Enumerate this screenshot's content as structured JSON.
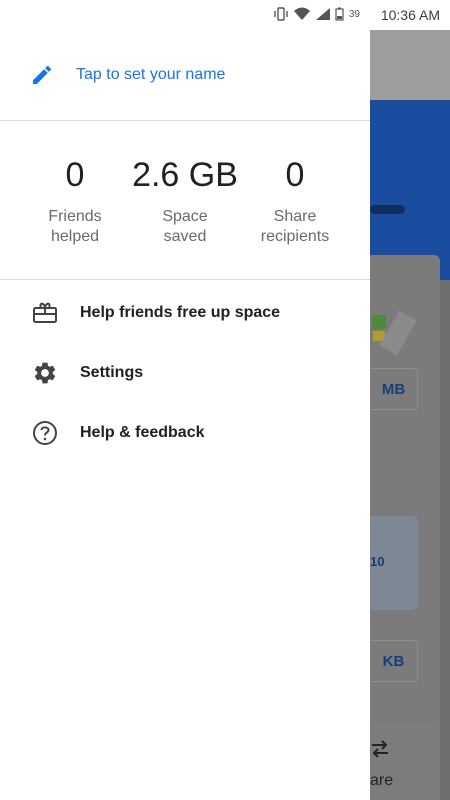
{
  "status_bar": {
    "time": "10:36 AM",
    "battery_level": "39",
    "icons": [
      "vibrate-icon",
      "wifi-icon",
      "signal-icon",
      "battery-icon"
    ]
  },
  "drawer": {
    "name_prompt": "Tap to set your name",
    "stats": [
      {
        "value": "0",
        "label_line1": "Friends",
        "label_line2": "helped"
      },
      {
        "value": "2.6 GB",
        "label_line1": "Space",
        "label_line2": "saved"
      },
      {
        "value": "0",
        "label_line1": "Share",
        "label_line2": "recipients"
      }
    ],
    "menu": [
      {
        "label": "Help friends free up space",
        "icon": "gift-card-icon"
      },
      {
        "label": "Settings",
        "icon": "gear-icon"
      },
      {
        "label": "Help & feedback",
        "icon": "help-circle-icon"
      }
    ]
  },
  "background": {
    "card1_button": "MB",
    "card2_image_text": "10",
    "card2_button": "KB",
    "share_label": "are"
  },
  "colors": {
    "accent": "#1a73e8",
    "scrim_blue": "#1a4ca0"
  }
}
